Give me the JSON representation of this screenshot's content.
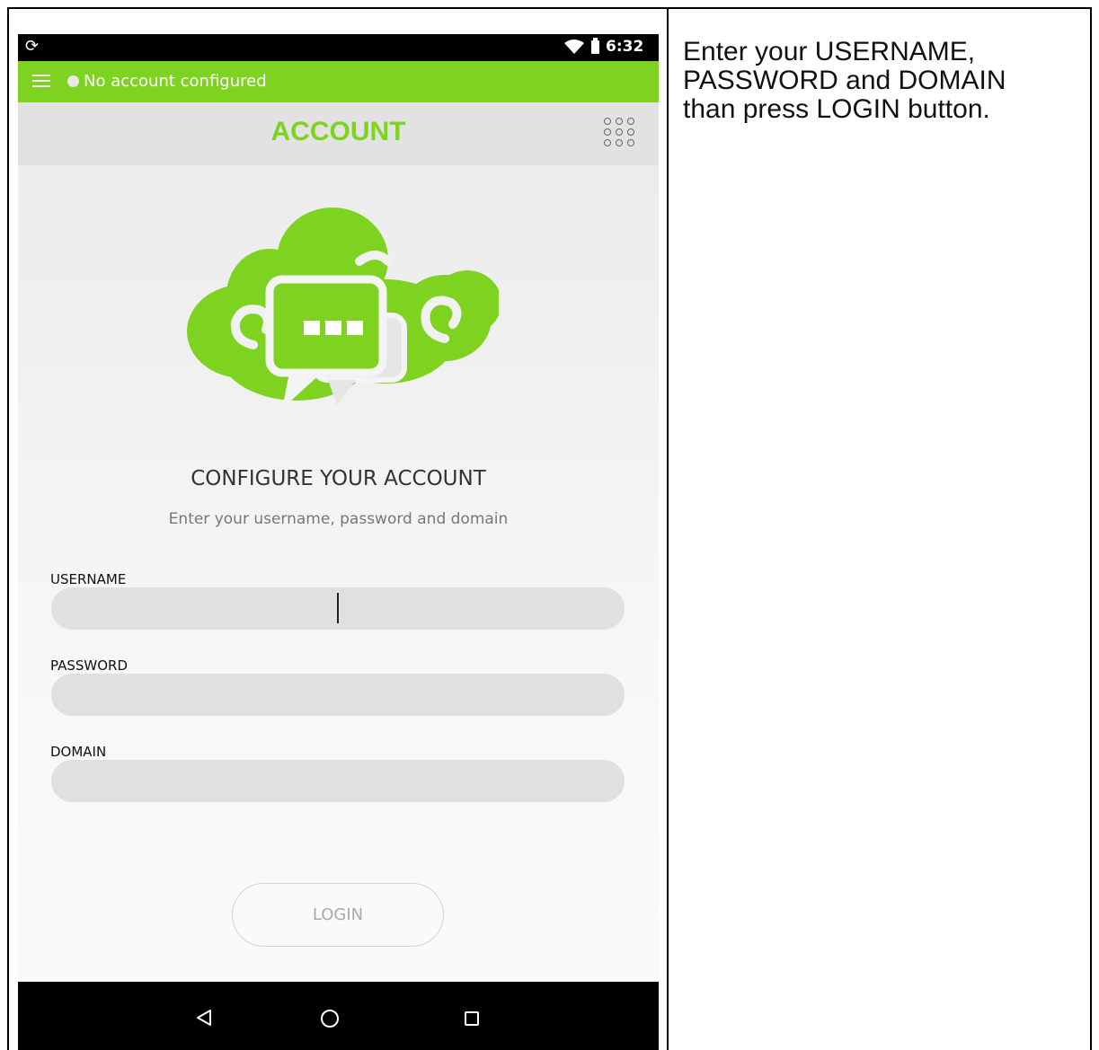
{
  "document": {
    "instruction": "Enter your USERNAME,\nPASSWORD and DOMAIN\nthan press LOGIN button."
  },
  "status_bar": {
    "time": "6:32",
    "icons": [
      "sync-icon",
      "wifi-icon",
      "battery-icon"
    ]
  },
  "top_bar": {
    "menu_icon": "hamburger-menu-icon",
    "account_status": "No account configured"
  },
  "title_bar": {
    "title": "ACCOUNT",
    "dialpad_icon": "dialpad-icon"
  },
  "form": {
    "heading": "CONFIGURE YOUR ACCOUNT",
    "subheading": "Enter your username, password and domain",
    "username": {
      "label": "USERNAME",
      "value": ""
    },
    "password": {
      "label": "PASSWORD",
      "value": ""
    },
    "domain": {
      "label": "DOMAIN",
      "value": ""
    },
    "login_label": "LOGIN"
  },
  "nav_bar": {
    "icons": [
      "back-icon",
      "home-icon",
      "recents-icon"
    ]
  },
  "colors": {
    "brand_green": "#7ED321",
    "field_gray": "#E0E0E0",
    "title_bar_gray": "#E2E2E2"
  }
}
